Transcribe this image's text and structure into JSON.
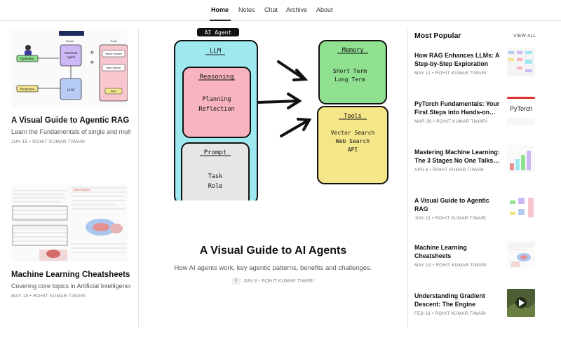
{
  "nav": {
    "items": [
      "Home",
      "Notes",
      "Chat",
      "Archive",
      "About"
    ],
    "active": "Home"
  },
  "left": {
    "cards": [
      {
        "title": "A Visual Guide to Agentic RAG",
        "desc": "Learn the Fundamentals of single and multi-agent RAG",
        "meta": "JUN 15 • ROHIT KUMAR TIWARI"
      },
      {
        "title": "Machine Learning Cheatsheets",
        "desc": "Covering core topics in Artificial Intelligence and ML",
        "meta": "MAY 18 • ROHIT KUMAR TIWARI"
      }
    ],
    "diagram": {
      "question": "Question",
      "router": "Router",
      "retrieval": "Retrieval Agent",
      "tools": "Tools",
      "response": "Response",
      "llm": "LLM",
      "vector": "Vector Search",
      "web": "Web Search",
      "api": "APIs"
    }
  },
  "hero": {
    "title": "A Visual Guide to AI Agents",
    "subtitle": "How AI agents work, key agentic patterns, benefits and challenges.",
    "meta": "JUN 8 • ROHIT KUMAR TIWARI",
    "image": {
      "banner": "AI Agent",
      "llm": "LLM",
      "reasoning": "Reasoning",
      "planning": "Planning",
      "reflection": "Reflection",
      "prompt": "Prompt",
      "task": "Task",
      "role": "Role",
      "memory": "Memory",
      "short_term": "Short Term",
      "long_term": "Long Term",
      "tools": "Tools",
      "vector": "Vector Search",
      "web": "Web Search",
      "api": "API"
    }
  },
  "popular": {
    "heading": "Most Popular",
    "view_all": "VIEW ALL",
    "items": [
      {
        "title": "How RAG Enhances LLMs: A Step-by-Step Exploration",
        "meta": "MAY 11 • ROHIT KUMAR TIWARI"
      },
      {
        "title": "PyTorch Fundamentals: Your First Steps into Hands-on…",
        "meta": "MAR 30 • ROHIT KUMAR TIWARI"
      },
      {
        "title": "Mastering Machine Learning: The 3 Stages No One Talks…",
        "meta": "APR 6 • ROHIT KUMAR TIWARI"
      },
      {
        "title": "A Visual Guide to Agentic RAG",
        "meta": "JUN 15 • ROHIT KUMAR TIWARI"
      },
      {
        "title": "Machine Learning Cheatsheets",
        "meta": "MAY 18 • ROHIT KUMAR TIWARI"
      },
      {
        "title": "Understanding Gradient Descent: The Engine Behin…",
        "meta": "FEB 16 • ROHIT KUMAR TIWARI"
      }
    ],
    "thumb_texts": {
      "pytorch": "PyTorch"
    }
  },
  "colors": {
    "accent_green": "#8fe08f",
    "accent_pink": "#f7b3c0",
    "accent_cyan": "#9ee8f0",
    "accent_yellow": "#f6e68a"
  }
}
